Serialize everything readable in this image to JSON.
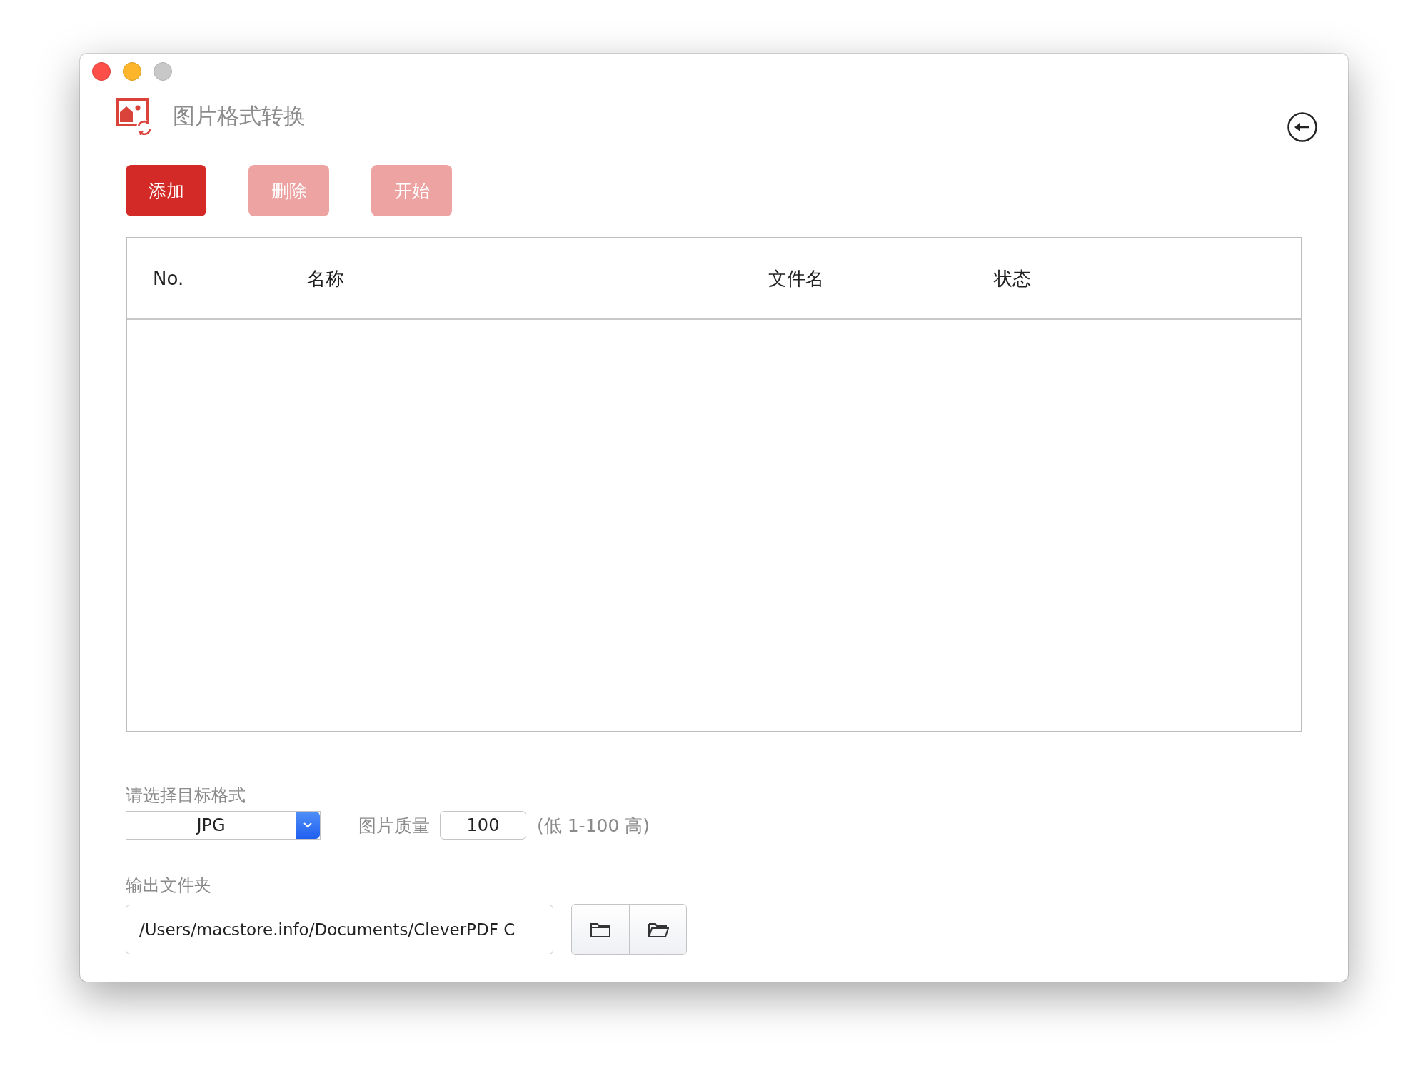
{
  "window": {
    "title": "图片格式转换"
  },
  "toolbar": [
    {
      "label": "添加",
      "disabled": false
    },
    {
      "label": "删除",
      "disabled": true
    },
    {
      "label": "开始",
      "disabled": true
    }
  ],
  "table": {
    "columns": [
      "No.",
      "名称",
      "文件名",
      "状态"
    ]
  },
  "format": {
    "label": "请选择目标格式",
    "value": "JPG"
  },
  "quality": {
    "label": "图片质量",
    "value": "100",
    "hint": "(低 1-100 高)"
  },
  "output": {
    "label": "输出文件夹",
    "value": "/Users/macstore.info/Documents/CleverPDF C"
  }
}
